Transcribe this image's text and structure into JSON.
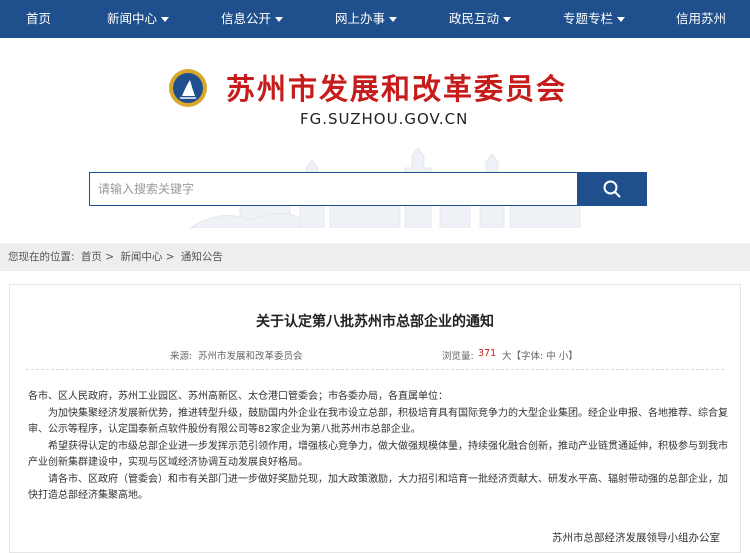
{
  "nav": {
    "items": [
      {
        "label": "首页",
        "dropdown": false
      },
      {
        "label": "新闻中心",
        "dropdown": true
      },
      {
        "label": "信息公开",
        "dropdown": true
      },
      {
        "label": "网上办事",
        "dropdown": true
      },
      {
        "label": "政民互动",
        "dropdown": true
      },
      {
        "label": "专题专栏",
        "dropdown": true
      },
      {
        "label": "信用苏州",
        "dropdown": false
      }
    ]
  },
  "header": {
    "site_title": "苏州市发展和改革委员会",
    "site_domain": "FG.SUZHOU.GOV.CN",
    "emblem_icon": "emblem-logo-icon"
  },
  "search": {
    "placeholder": "请输入搜索关键字",
    "button_icon": "search-icon"
  },
  "breadcrumb": {
    "prefix": "您现在的位置:",
    "items": [
      "首页",
      "新闻中心",
      "通知公告"
    ],
    "separator": ">"
  },
  "article": {
    "title": "关于认定第八批苏州市总部企业的通知",
    "source_label": "来源:",
    "source": "苏州市发展和改革委员会",
    "views_label": "浏览量:",
    "views": "371",
    "font_label": "大【字体: 中 小】",
    "paragraphs": [
      "各市、区人民政府，苏州工业园区、苏州高新区、太仓港口管委会；市各委办局，各直属单位：",
      "为加快集聚经济发展新优势，推进转型升级，鼓励国内外企业在我市设立总部，积极培育具有国际竞争力的大型企业集团。经企业申报、各地推荐、综合复审、公示等程序，认定国泰新点软件股份有限公司等82家企业为第八批苏州市总部企业。",
      "希望获得认定的市级总部企业进一步发挥示范引领作用，增强核心竞争力，做大做强规模体量，持续强化融合创新，推动产业链贯通延伸，积极参与到我市产业创新集群建设中，实现与区域经济协调互动发展良好格局。",
      "请各市、区政府（管委会）和市有关部门进一步做好奖励兑现，加大政策激励，大力招引和培育一批经济贡献大、研发水平高、辐射带动强的总部企业，加快打造总部经济集聚高地。"
    ],
    "signature": "苏州市总部经济发展领导小组办公室"
  },
  "colors": {
    "nav_bg": "#1f4f8c",
    "title_red": "#c61c1c",
    "breadcrumb_bg": "#eeeeee"
  }
}
